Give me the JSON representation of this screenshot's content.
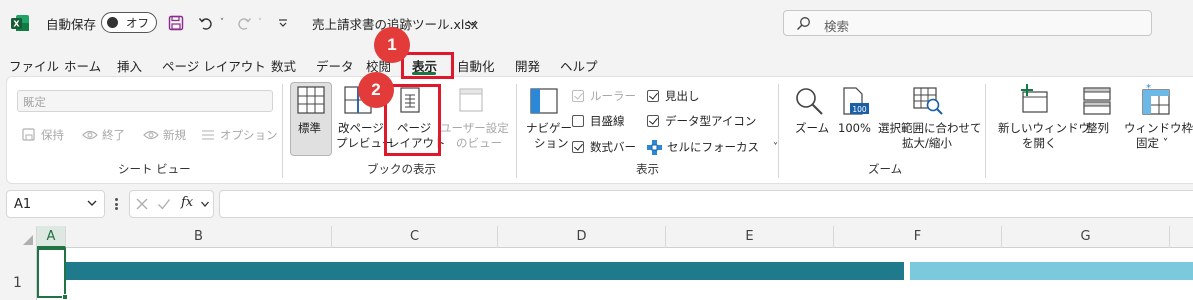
{
  "titlebar": {
    "autosave_label": "自動保存",
    "autosave_state": "オフ",
    "filename": "売上請求書の追跡ツール.xlsx",
    "search_placeholder": "検索"
  },
  "tabs": [
    "ファイル",
    "ホーム",
    "挿入",
    "ページ レイアウト",
    "数式",
    "データ",
    "校閲",
    "表示",
    "自動化",
    "開発",
    "ヘルプ"
  ],
  "active_tab": "表示",
  "ribbon": {
    "sheet_view": {
      "dropdown_value": "既定",
      "keep": "保持",
      "exit": "終了",
      "new": "新規",
      "options": "オプション",
      "label": "シート ビュー"
    },
    "workbook_views": {
      "normal": "標準",
      "page_break_preview": [
        "改ページ",
        "プレビュー"
      ],
      "page_layout": [
        "ページ",
        "レイアウト"
      ],
      "custom_views": [
        "ユーザー設定",
        "のビュー"
      ],
      "label": "ブックの表示"
    },
    "show": {
      "navigation": [
        "ナビゲー",
        "ション"
      ],
      "ruler": "ルーラー",
      "gridlines": "目盛線",
      "formula_bar": "数式バー",
      "headings": "見出し",
      "data_type_icons": "データ型アイコン",
      "focus_cell": "セルにフォーカス",
      "label": "表示"
    },
    "zoom": {
      "zoom": "ズーム",
      "hundred": "100%",
      "zoom_to_selection": [
        "選択範囲に合わせて",
        "拡大/縮小"
      ],
      "label": "ズーム"
    },
    "window": {
      "new_window": [
        "新しいウィンドウ",
        "を開く"
      ],
      "arrange_all": "整列",
      "freeze_panes": [
        "ウィンドウ枠の",
        "固定 ˅"
      ]
    }
  },
  "callouts": [
    "1",
    "2"
  ],
  "formula_bar": {
    "name_box": "A1",
    "fx": "fx"
  },
  "columns": [
    "A",
    "B",
    "C",
    "D",
    "E",
    "F",
    "G"
  ],
  "rows": [
    "1"
  ],
  "colors": {
    "accent_green": "#217346",
    "callout_red": "#e0182b",
    "banner_dark": "#1f7a8c",
    "banner_light": "#7ac9dd"
  }
}
